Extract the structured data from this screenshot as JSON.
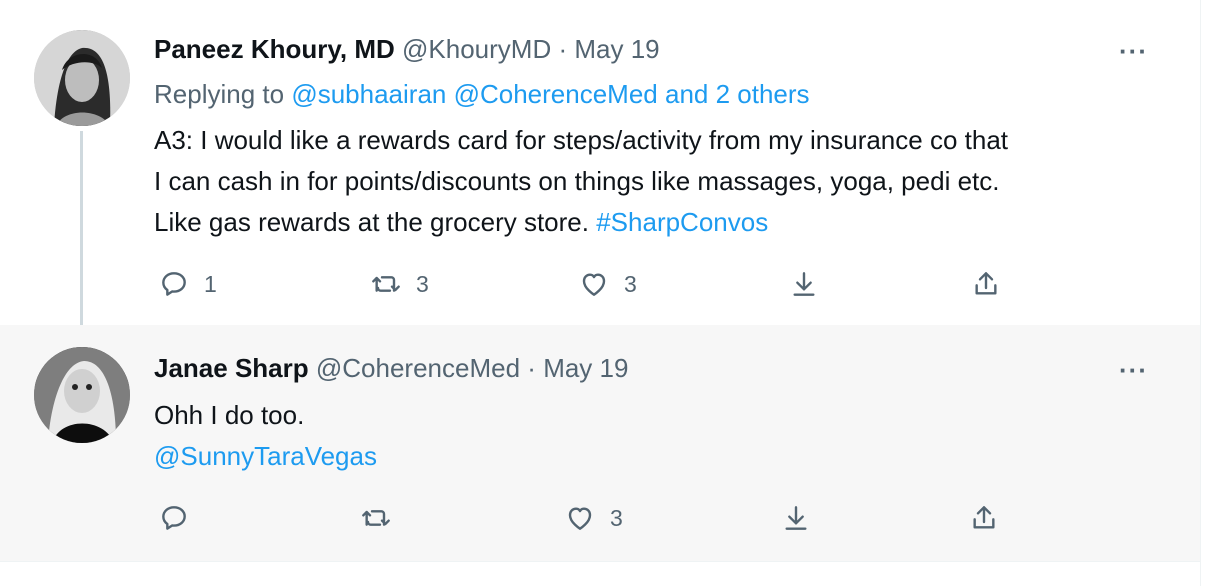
{
  "tweets": [
    {
      "author_name": "Paneez Khoury, MD",
      "handle": "@KhouryMD",
      "separator": "·",
      "date": "May 19",
      "more_label": "···",
      "replying_prefix": "Replying to",
      "replying_users": "@subhaairan @CoherenceMed",
      "replying_others": "and 2 others",
      "text_lines": [
        "A3: I would like a rewards card for steps/activity from my insurance co that",
        "I can cash in for points/discounts on things like massages, yoga, pedi etc.",
        "Like gas rewards at the grocery store."
      ],
      "hashtag": "#SharpConvos",
      "counts": {
        "replies": "1",
        "retweets": "3",
        "likes": "3"
      }
    },
    {
      "author_name": "Janae Sharp",
      "handle": "@CoherenceMed",
      "separator": "·",
      "date": "May 19",
      "more_label": "···",
      "text_line": "Ohh I do too.",
      "mention": "@SunnyTaraVegas",
      "counts": {
        "replies": "",
        "retweets": "",
        "likes": "3"
      }
    }
  ],
  "icons": {
    "reply": "reply-icon",
    "retweet": "retweet-icon",
    "like": "heart-icon",
    "save": "download-icon",
    "share": "share-icon"
  },
  "colors": {
    "link": "#1d9bf0",
    "muted": "#536471",
    "text": "#0f1419",
    "highlight_bg": "#f7f7f7"
  }
}
